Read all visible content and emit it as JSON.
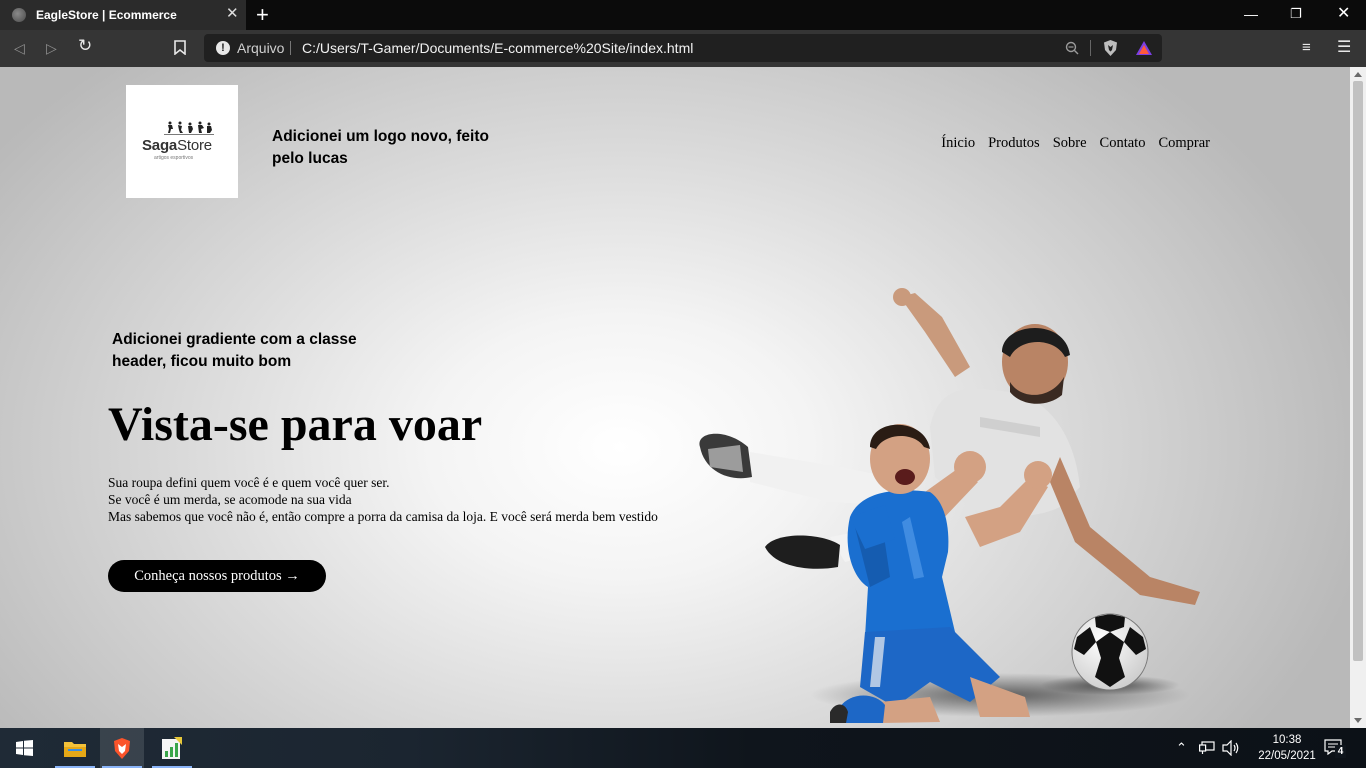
{
  "browser": {
    "tab_title": "EagleStore | Ecommerce",
    "new_tab_symbol": "+",
    "address": {
      "scheme_label": "Arquivo",
      "url": "C:/Users/T-Gamer/Documents/E-commerce%20Site/index.html"
    },
    "icons": [
      "globe-icon",
      "close-icon",
      "back-icon",
      "forward-icon",
      "reload-icon",
      "bookmark-icon",
      "info-icon",
      "zoom-icon",
      "brave-shield-icon",
      "brave-rewards-icon",
      "playlist-icon",
      "menu-icon",
      "minimize-icon",
      "restore-icon",
      "window-close-icon"
    ]
  },
  "page": {
    "logo": {
      "brand_bold": "Saga",
      "brand_regular": "Store",
      "tagline": "artigos esportivos"
    },
    "header_note": "Adicionei um logo novo, feito pelo lucas",
    "nav": [
      "Ínicio",
      "Produtos",
      "Sobre",
      "Contato",
      "Comprar"
    ],
    "hero": {
      "note": "Adicionei gradiente com a classe header, ficou muito bom",
      "title": "Vista-se para voar",
      "paragraph_lines": [
        "Sua roupa defini quem você é e quem você quer ser.",
        "Se você é um merda, se acomode na sua vida",
        "Mas sabemos que você não é, então compre a porra da camisa da loja. E você será merda bem vestido"
      ],
      "cta_label": "Conheça nossos produtos →"
    }
  },
  "taskbar": {
    "apps": [
      "windows-start-icon",
      "file-explorer-icon",
      "brave-browser-icon",
      "chart-app-icon"
    ],
    "clock": {
      "time": "10:38",
      "date": "22/05/2021"
    },
    "notification_count": "4",
    "colors": {
      "accent": "#8ab4f8",
      "cta_bg": "#000000"
    }
  }
}
